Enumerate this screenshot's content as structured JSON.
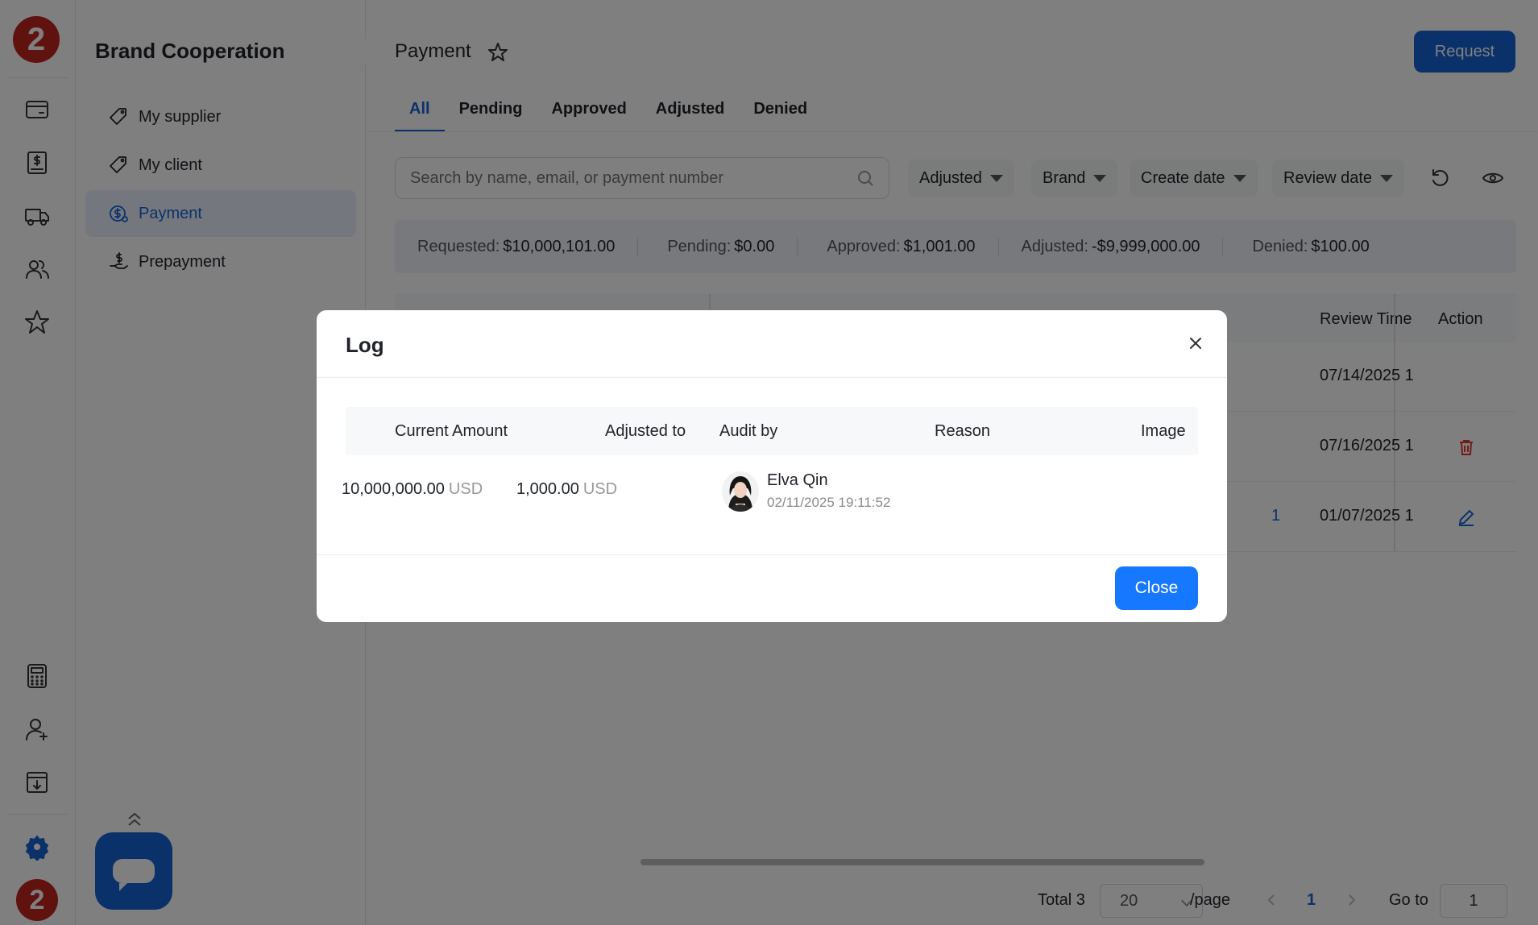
{
  "rail": {
    "logo_text": "2",
    "bottom_avatar_text": "2",
    "icons": [
      "wallet-icon",
      "dollar-document-icon",
      "truck-icon",
      "users-icon",
      "star-icon",
      "calculator-icon",
      "user-icon",
      "download-box-icon",
      "gear-icon"
    ]
  },
  "sidebar": {
    "title": "Brand Cooperation",
    "items": [
      {
        "label": "My supplier",
        "icon": "tag-icon"
      },
      {
        "label": "My client",
        "icon": "tag-icon"
      },
      {
        "label": "Payment",
        "icon": "dollar-circle-icon",
        "active": true
      },
      {
        "label": "Prepayment",
        "icon": "hand-dollar-icon"
      }
    ]
  },
  "header": {
    "title": "Payment",
    "request_label": "Request"
  },
  "tabs": [
    {
      "label": "All",
      "active": true
    },
    {
      "label": "Pending"
    },
    {
      "label": "Approved"
    },
    {
      "label": "Adjusted"
    },
    {
      "label": "Denied"
    }
  ],
  "search": {
    "placeholder": "Search by name, email, or payment number"
  },
  "filters": [
    "Adjusted",
    "Brand",
    "Create date",
    "Review date"
  ],
  "summary": [
    {
      "key": "Requested:",
      "value": "$10,000,101.00"
    },
    {
      "key": "Pending:",
      "value": "$0.00"
    },
    {
      "key": "Approved:",
      "value": "$1,001.00"
    },
    {
      "key": "Adjusted:",
      "value": "-$9,999,000.00"
    },
    {
      "key": "Denied:",
      "value": "$100.00"
    }
  ],
  "table": {
    "headers": {
      "review_time": "Review Time",
      "action": "Action"
    },
    "rows": [
      {
        "review_time": "07/14/2025 1"
      },
      {
        "review_time": "07/16/2025 1"
      },
      {
        "review_time": "01/07/2025 1",
        "count": "1"
      }
    ]
  },
  "pagination": {
    "total": "Total 3",
    "page_size": "20",
    "per_page": "/page",
    "current_page": "1",
    "goto_label": "Go to",
    "goto_value": "1"
  },
  "modal": {
    "title": "Log",
    "columns": [
      "Current Amount",
      "Adjusted to",
      "Audit by",
      "Reason",
      "Image"
    ],
    "entry": {
      "current_amount": "10,000,000.00",
      "current_currency": "USD",
      "adjusted_amount": "1,000.00",
      "adjusted_currency": "USD",
      "auditor_name": "Elva Qin",
      "audit_time": "02/11/2025 19:11:52",
      "reason": "",
      "image": ""
    },
    "close_label": "Close"
  },
  "colors": {
    "primary": "#1663d6",
    "close_button": "#1677ff",
    "logo": "#c0251f",
    "delete": "#e53935"
  }
}
